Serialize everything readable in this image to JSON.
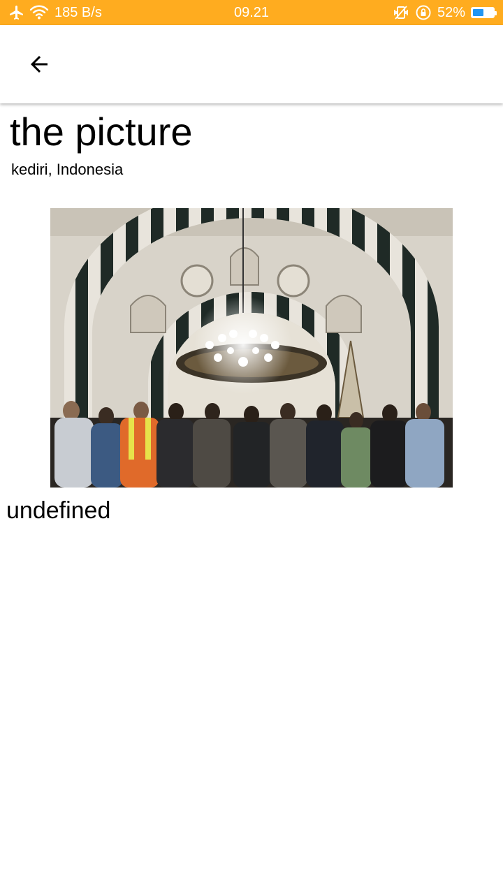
{
  "status_bar": {
    "network_speed": "185 B/s",
    "time": "09.21",
    "battery_percent": "52%",
    "battery_level": 0.52,
    "background_color": "#ffac1f",
    "icons": [
      "airplane-icon",
      "wifi-icon",
      "vibrate-icon",
      "rotation-lock-icon",
      "battery-icon"
    ]
  },
  "app_bar": {
    "back_icon": "arrow-back-icon"
  },
  "content": {
    "title": "the picture",
    "location": "kediri, Indonesia",
    "description": "undefined"
  }
}
